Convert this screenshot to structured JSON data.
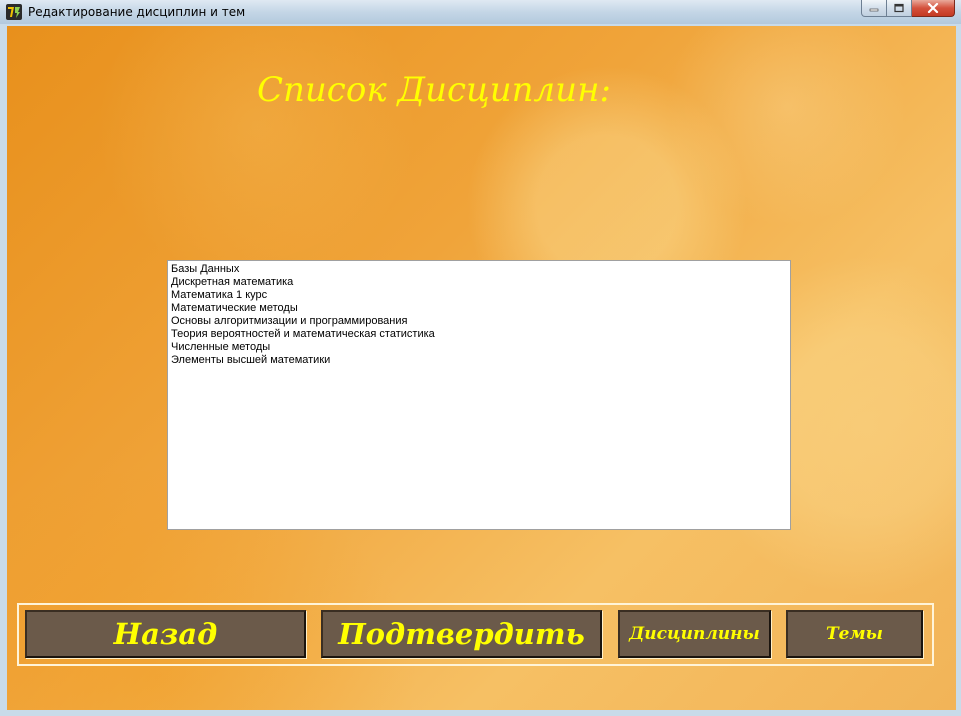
{
  "window": {
    "title": "Редактирование дисциплин и тем",
    "icon": "app-icon"
  },
  "main": {
    "title": "Список Дисциплин:",
    "disciplines": [
      "Базы Данных",
      "Дискретная математика",
      "Математика 1 курс",
      "Математические методы",
      "Основы алгоритмизации и программирования",
      "Теория вероятностей и математическая статистика",
      "Численные методы",
      "Элементы высшей математики"
    ]
  },
  "buttons": {
    "back": "Назад",
    "confirm": "Подтвердить",
    "disciplines": "Дисциплины",
    "topics": "Темы"
  },
  "colors": {
    "accent_text": "#ffff00",
    "button_bg": "#6b5a4a",
    "background": "#f0a43a"
  }
}
